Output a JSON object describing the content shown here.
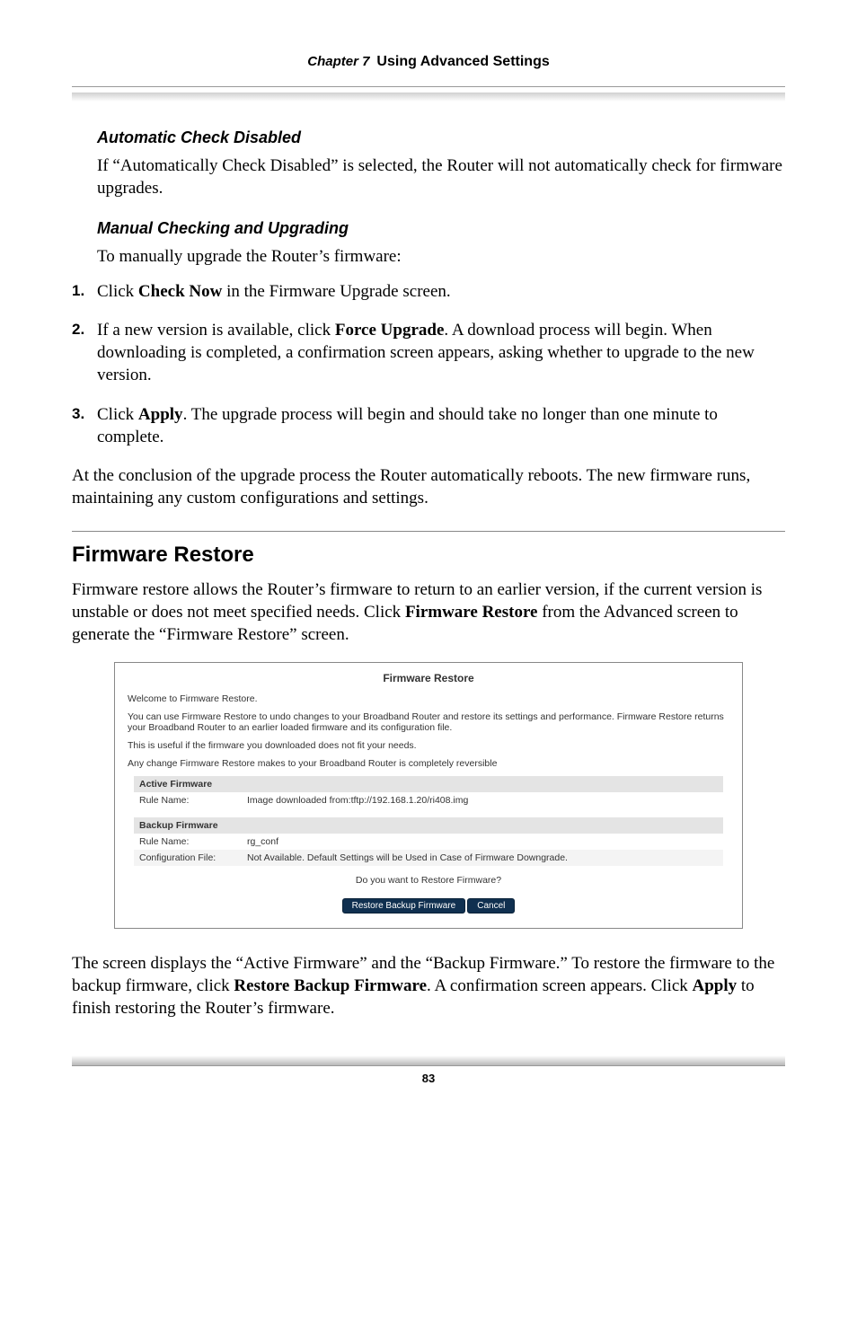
{
  "header": {
    "chapter_label": "Chapter 7",
    "chapter_title": "Using Advanced Settings"
  },
  "sec1": {
    "heading": "Automatic Check Disabled",
    "para": "If “Automatically Check Disabled” is selected, the Router will not automatically check for firmware upgrades."
  },
  "sec2": {
    "heading": "Manual Checking and Upgrading",
    "intro": "To manually upgrade the Router’s firmware:",
    "s1a": "Click ",
    "s1b": "Check Now",
    "s1c": " in the Firmware Upgrade screen.",
    "s2a": "If a new version is available, click ",
    "s2b": "Force Upgrade",
    "s2c": ". A download process will begin. When downloading is completed, a confirmation screen appears, asking whether to upgrade to the new version.",
    "s3a": "Click ",
    "s3b": "Apply",
    "s3c": ". The upgrade process will begin and should take no longer than one minute to complete.",
    "outro": "At the conclusion of the upgrade process the Router automatically reboots. The new firmware runs, maintaining any custom configurations and settings."
  },
  "sec3": {
    "heading": "Firmware Restore",
    "p1a": "Firmware restore allows the Router’s firmware to return to an earlier version, if the current version is unstable or does not meet specified needs. Click ",
    "p1b": "Firmware Restore",
    "p1c": " from the Advanced screen to generate the “Firmware Restore” screen.",
    "p2a": "The screen displays the “Active Firmware” and the “Backup Firmware.” To restore the firmware to the backup firmware, click ",
    "p2b": "Restore Backup Firmware",
    "p2c": ". A confirmation screen appears. Click ",
    "p2d": "Apply",
    "p2e": " to finish restoring the Router’s firmware."
  },
  "ss": {
    "title": "Firmware Restore",
    "welcome": "Welcome to Firmware Restore.",
    "desc": "You can use Firmware Restore to undo changes to your Broadband Router and restore its settings and performance. Firmware Restore returns your Broadband Router to an earlier loaded firmware and its configuration file.",
    "useful": "This is useful if the firmware you downloaded does not fit your needs.",
    "reversible": "Any change Firmware Restore makes to your Broadband Router is completely reversible",
    "active_head": "Active Firmware",
    "rule_label": "Rule Name:",
    "active_rule": "Image downloaded from:tftp://192.168.1.20/ri408.img",
    "backup_head": "Backup Firmware",
    "backup_rule": "rg_conf",
    "conf_label": "Configuration File:",
    "conf_val": "Not Available. Default Settings will be Used in Case of Firmware Downgrade.",
    "confirm_q": "Do you want to Restore Firmware?",
    "btn_restore": "Restore Backup Firmware",
    "btn_cancel": "Cancel"
  },
  "footer": {
    "page": "83"
  }
}
